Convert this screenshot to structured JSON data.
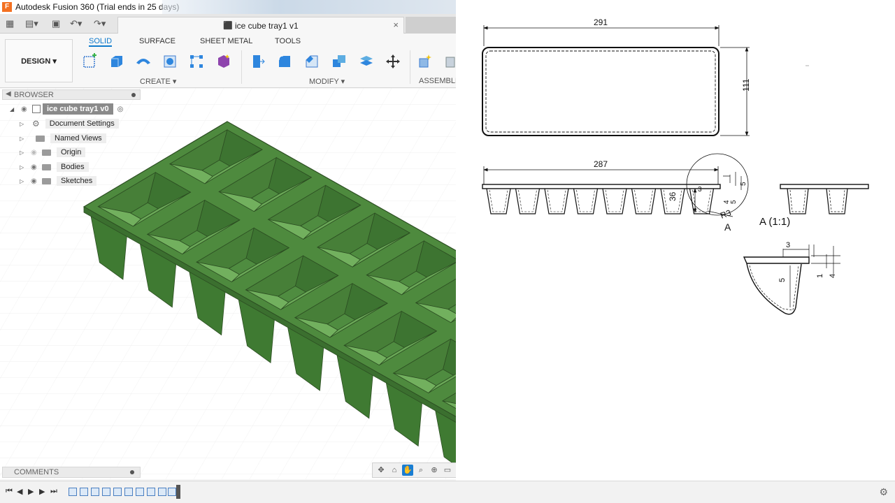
{
  "window": {
    "title": "Autodesk Fusion 360 (Trial ends in 25 days)",
    "app_letter": "F"
  },
  "document": {
    "tab_title": "ice cube tray1 v1",
    "close_glyph": "×"
  },
  "workspace": {
    "label": "DESIGN ▾"
  },
  "ribbon": {
    "tabs": [
      "SOLID",
      "SURFACE",
      "SHEET METAL",
      "TOOLS"
    ],
    "groups": {
      "create": "CREATE ▾",
      "modify": "MODIFY ▾",
      "assemble": "ASSEMBLE"
    }
  },
  "browser": {
    "header": "BROWSER",
    "root": "ice cube tray1 v0",
    "items": [
      "Document Settings",
      "Named Views",
      "Origin",
      "Bodies",
      "Sketches"
    ]
  },
  "comments": {
    "header": "COMMENTS"
  },
  "drawing": {
    "top_width": "291",
    "top_height": "111",
    "side_length": "287",
    "side_depth": "36",
    "radius": "R3",
    "small_dims": [
      "3",
      "4",
      "5",
      "5"
    ],
    "section_marker": "A",
    "detail_title": "A (1:1)",
    "detail_dims": {
      "top": "3",
      "depth": "5",
      "rim1": "1",
      "rim2": "4"
    }
  },
  "colors": {
    "model_green": "#4e8a3e",
    "accent_blue": "#0f7acc"
  },
  "icons": [
    "grid-icon",
    "file-icon",
    "save-icon",
    "undo-icon",
    "redo-icon",
    "settings-icon"
  ]
}
